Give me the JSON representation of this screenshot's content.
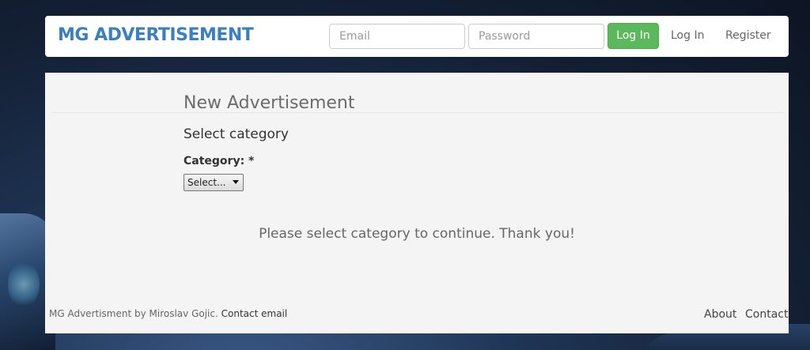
{
  "header": {
    "brand": "MG ADVERTISEMENT",
    "email_placeholder": "Email",
    "password_placeholder": "Password",
    "login_button": "Log In",
    "nav_login": "Log In",
    "nav_register": "Register"
  },
  "main": {
    "title": "New Advertisement",
    "section_title": "Select category",
    "category_label": "Category: *",
    "category_selected": "Select...",
    "message": "Please select category to continue. Thank you!"
  },
  "footer": {
    "credit": "MG Advertisment by Miroslav Gojic.",
    "contact_email": "Contact email",
    "about": "About",
    "contact": "Contact"
  },
  "colors": {
    "brand": "#3a7fc1",
    "login_button": "#5cb85c",
    "panel_background": "#f4f4f4"
  }
}
